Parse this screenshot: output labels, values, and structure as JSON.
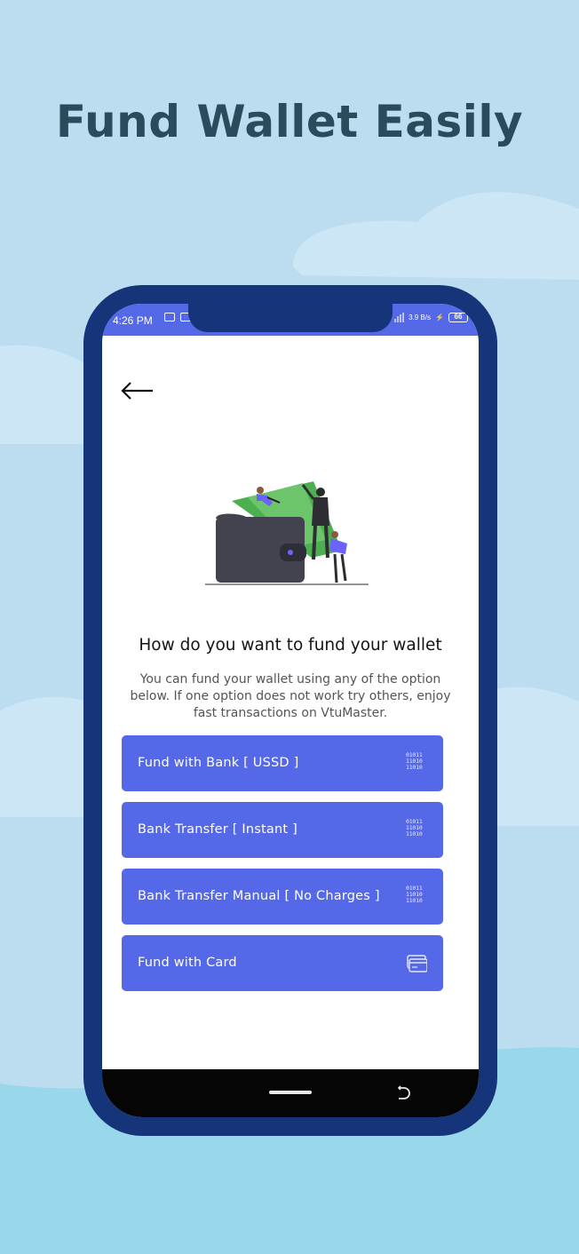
{
  "headline": "Fund Wallet Easily",
  "colors": {
    "background": "#bcdcf0",
    "phone_frame": "#15347a",
    "accent": "#5569e8",
    "headline": "#2b4a5c"
  },
  "status_bar": {
    "time": "4:26 PM",
    "network_speed": "3.9 B/s",
    "battery": "66"
  },
  "back_icon": "arrow-left-icon",
  "title": "How do you want to fund your wallet",
  "description": "You can fund your wallet using any of the option below. If one option does not work try others, enjoy fast transactions on VtuMaster.",
  "options": [
    {
      "label": "Fund with Bank [ USSD ]",
      "icon": "binary-icon"
    },
    {
      "label": "Bank Transfer [ Instant ]",
      "icon": "binary-icon"
    },
    {
      "label": "Bank Transfer Manual [ No Charges ]",
      "icon": "binary-icon"
    },
    {
      "label": "Fund with Card",
      "icon": "credit-card-icon"
    }
  ]
}
